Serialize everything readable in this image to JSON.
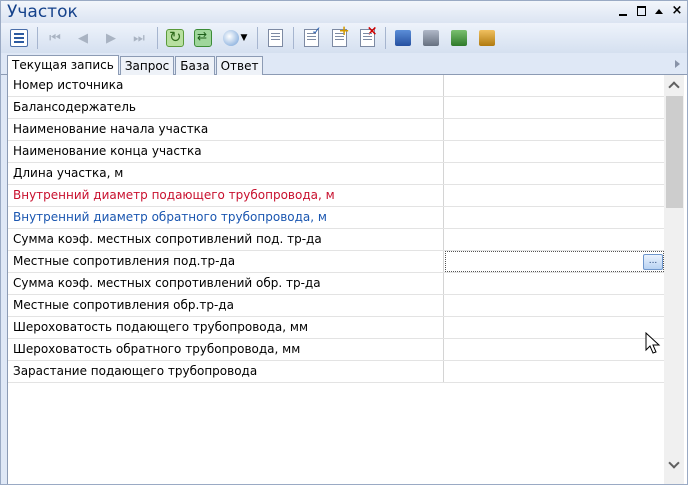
{
  "window": {
    "title": "Участок"
  },
  "toolbar": {
    "buttons": [
      "grid-view-icon",
      "first-record-icon",
      "prev-record-icon",
      "next-record-icon",
      "last-record-icon",
      "refresh-icon",
      "refresh-all-icon",
      "filter-icon",
      "new-document-icon",
      "edit-document-icon",
      "add-document-icon",
      "delete-document-icon",
      "database-save-icon",
      "database-print-icon",
      "database-export-icon",
      "database-edit-icon"
    ]
  },
  "tabs": [
    {
      "label": "Текущая запись",
      "active": true
    },
    {
      "label": "Запрос",
      "active": false
    },
    {
      "label": "База",
      "active": false
    },
    {
      "label": "Ответ",
      "active": false
    }
  ],
  "grid": {
    "selected_row": 8,
    "rows": [
      {
        "label": "Номер источника",
        "color": "#000000"
      },
      {
        "label": "Балансодержатель",
        "color": "#000000"
      },
      {
        "label": "Наименование начала участка",
        "color": "#000000"
      },
      {
        "label": "Наименование конца участка",
        "color": "#000000"
      },
      {
        "label": "Длина участка, м",
        "color": "#000000"
      },
      {
        "label": "Внутренний диаметр подающего трубопровода, м",
        "color": "#c8102e"
      },
      {
        "label": "Внутренний диаметр обратного трубопровода, м",
        "color": "#1a56b0"
      },
      {
        "label": "Сумма коэф. местных сопротивлений под. тр-да",
        "color": "#000000"
      },
      {
        "label": "Местные сопротивления под.тр-да",
        "color": "#000000"
      },
      {
        "label": "Сумма коэф. местных сопротивлений обр. тр-да",
        "color": "#000000"
      },
      {
        "label": "Местные сопротивления обр.тр-да",
        "color": "#000000"
      },
      {
        "label": "Шероховатость подающего трубопровода, мм",
        "color": "#000000"
      },
      {
        "label": "Шероховатость обратного трубопровода, мм",
        "color": "#000000"
      },
      {
        "label": "Зарастание подающего трубопровода",
        "color": "#000000"
      }
    ],
    "ellipsis_button": "..."
  }
}
